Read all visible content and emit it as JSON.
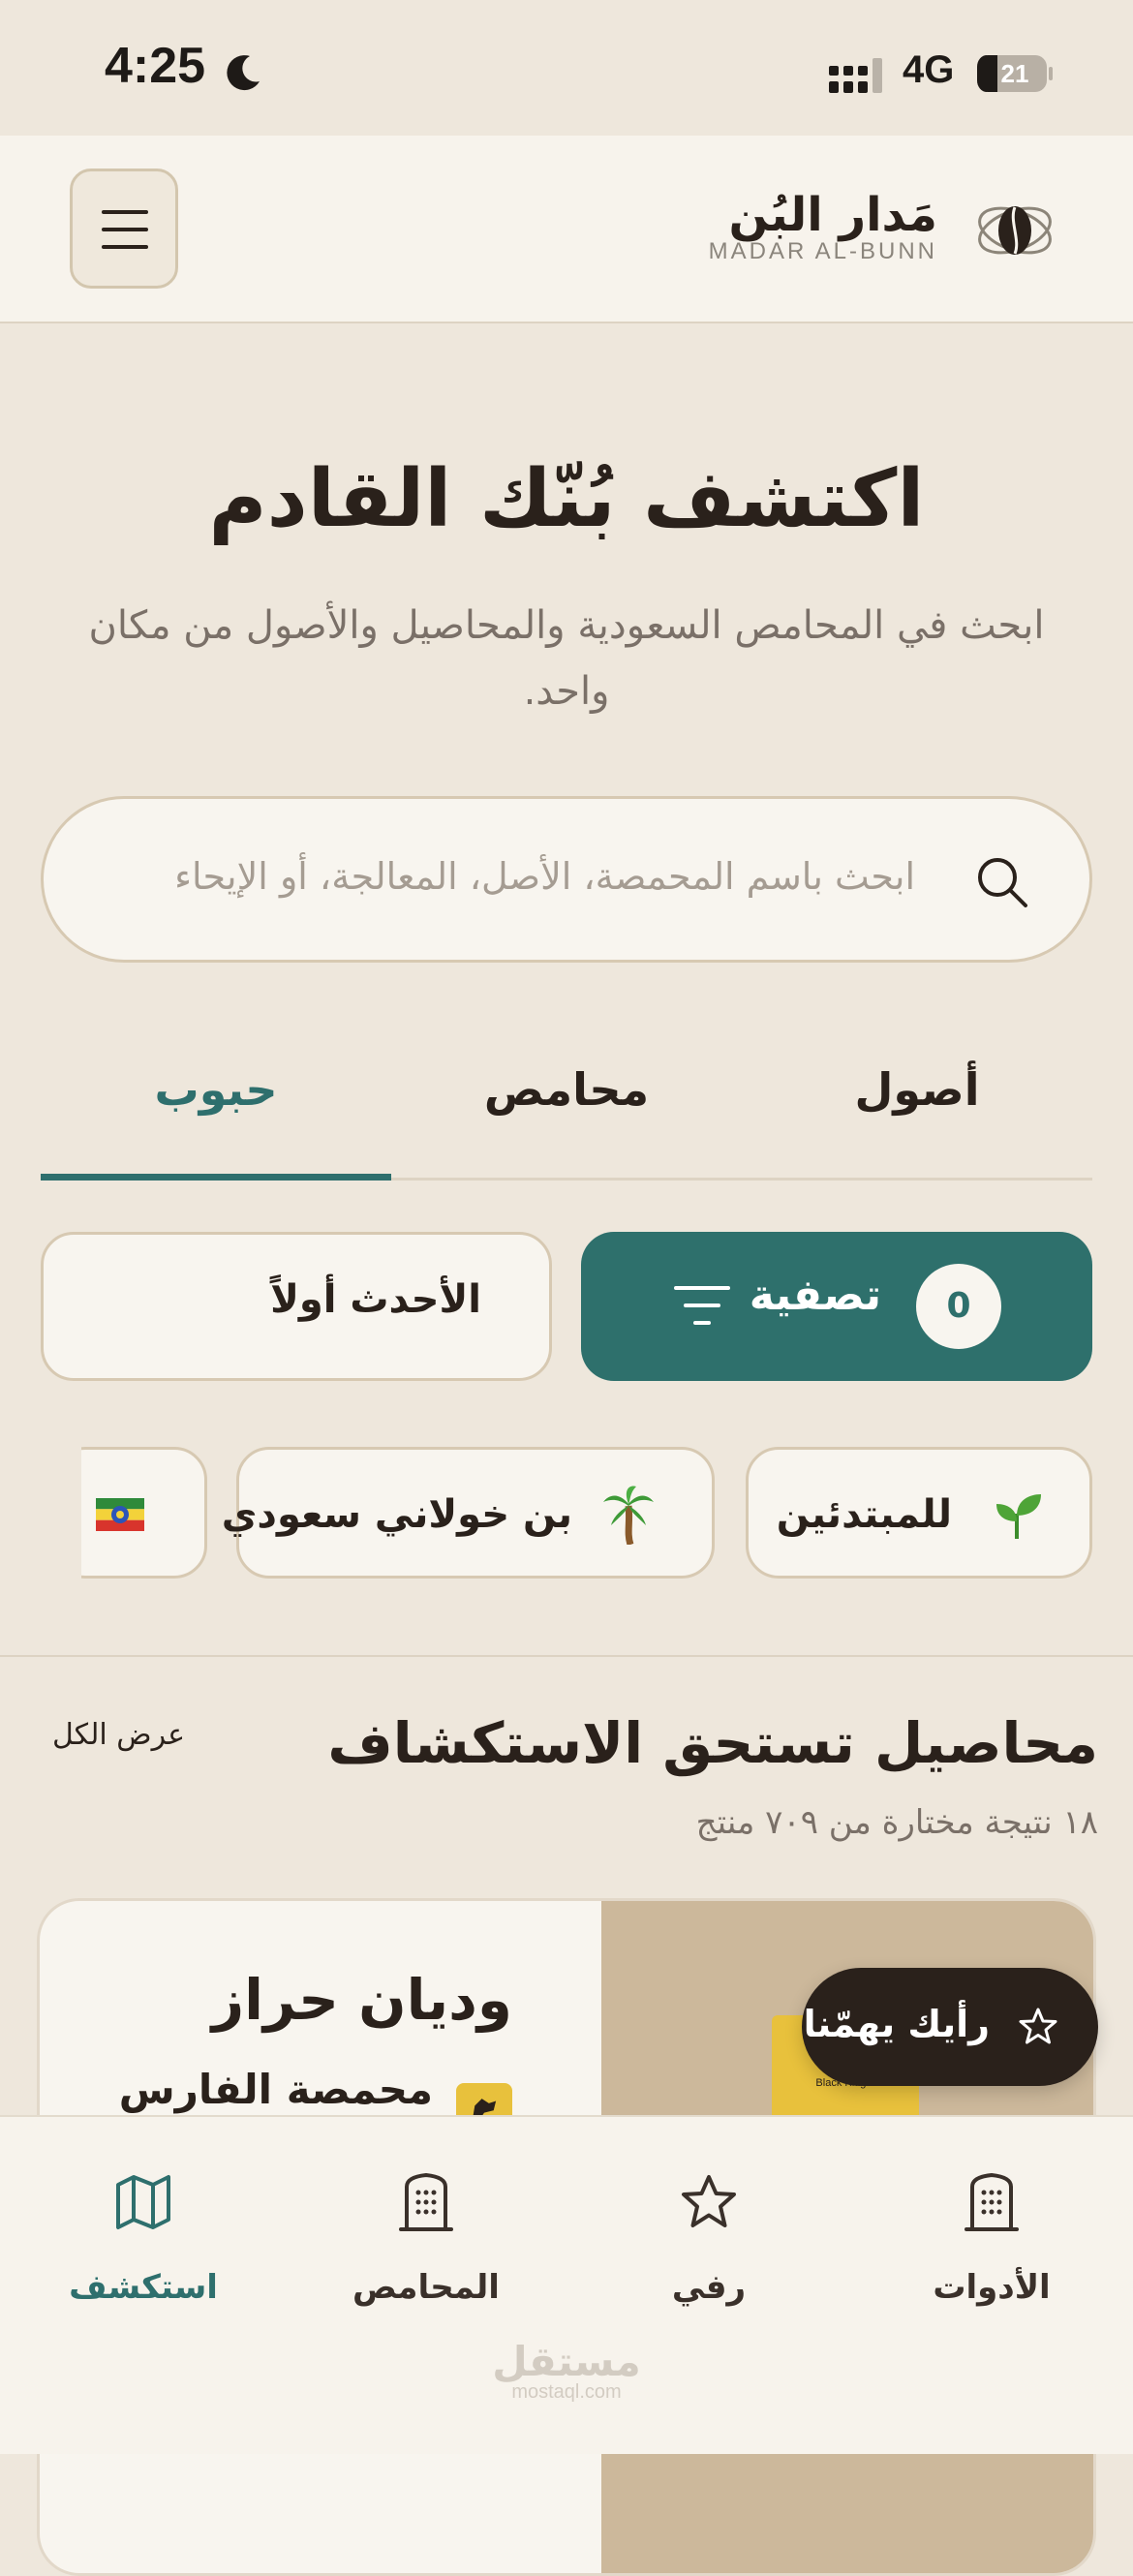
{
  "status_bar": {
    "time": "4:25",
    "network": "4G",
    "battery": "21"
  },
  "header": {
    "brand_name": "مَدار البُن",
    "brand_latin": "MADAR AL-BUNN"
  },
  "hero": {
    "title": "اكتشف بُنّك القادم",
    "subtitle": "ابحث في المحامص السعودية والمحاصيل والأصول من مكان واحد."
  },
  "search": {
    "placeholder": "ابحث باسم المحمصة، الأصل، المعالجة، أو الإيحاء"
  },
  "tabs": [
    {
      "label": "أصول",
      "active": false
    },
    {
      "label": "محامص",
      "active": false
    },
    {
      "label": "حبوب",
      "active": true
    }
  ],
  "filter": {
    "label": "تصفية",
    "count": "0"
  },
  "sort": {
    "label": "الأحدث أولاً"
  },
  "chips": [
    {
      "label": "للمبتدئين",
      "icon": "seedling-icon"
    },
    {
      "label": "بن خولاني سعودي",
      "icon": "palm-tree-icon"
    },
    {
      "label": "",
      "icon": "ethiopia-flag-icon"
    }
  ],
  "section": {
    "title": "محاصيل تستحق الاستكشاف",
    "view_all": "عرض الكل",
    "subtitle": "١٨ نتيجة مختارة من ٧٠٩ منتج"
  },
  "product": {
    "name": "وديان حراز",
    "roaster": "محمصة الفارس",
    "bag_brand": "Black Knight"
  },
  "feedback": {
    "label": "رأيك يهمّنا"
  },
  "bottom_nav": [
    {
      "label": "الأدوات",
      "icon": "building-icon",
      "active": false
    },
    {
      "label": "رفي",
      "icon": "star-icon",
      "active": false
    },
    {
      "label": "المحامص",
      "icon": "building-icon",
      "active": false
    },
    {
      "label": "استكشف",
      "icon": "map-icon",
      "active": true
    }
  ],
  "watermark": {
    "arabic": "مستقل",
    "latin": "mostaql.com"
  },
  "colors": {
    "accent": "#2e6f6d",
    "background": "#eee7dc",
    "dark": "#2a211b"
  }
}
